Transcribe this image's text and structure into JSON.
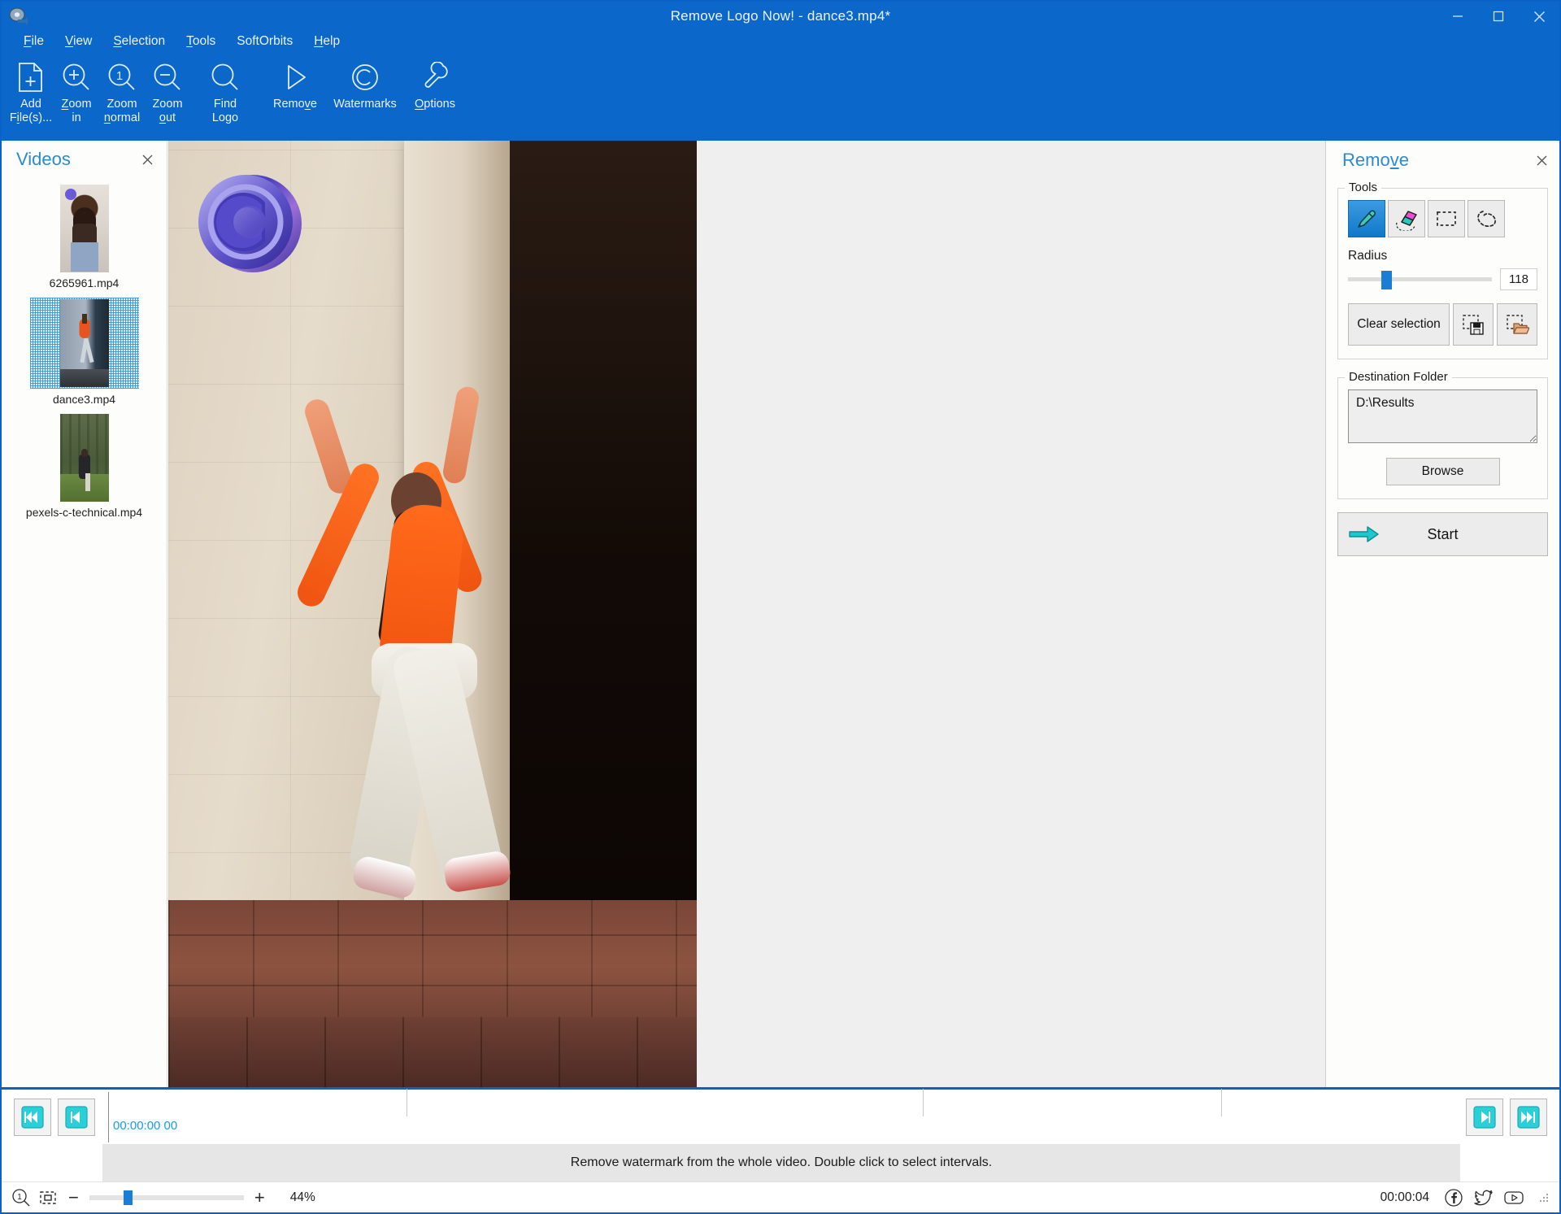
{
  "window": {
    "title": "Remove Logo Now! - dance3.mp4*",
    "app_icon": "disc-arrow-icon",
    "controls": {
      "minimize": "minimize-icon",
      "maximize": "maximize-icon",
      "close": "close-icon"
    }
  },
  "menu": {
    "items": [
      {
        "label": "File",
        "accel": "F"
      },
      {
        "label": "View",
        "accel": "V"
      },
      {
        "label": "Selection",
        "accel": "S"
      },
      {
        "label": "Tools",
        "accel": "T"
      },
      {
        "label": "SoftOrbits",
        "accel": ""
      },
      {
        "label": "Help",
        "accel": "H"
      }
    ]
  },
  "toolbar": {
    "groups": [
      {
        "buttons": [
          {
            "label": "Add\nFile(s)...",
            "icon": "add-file-icon",
            "name": "add-files-button"
          },
          {
            "label": "Zoom\nin",
            "icon": "zoom-in-icon",
            "name": "zoom-in-button"
          },
          {
            "label": "Zoom\nnormal",
            "icon": "zoom-normal-icon",
            "name": "zoom-normal-button"
          },
          {
            "label": "Zoom\nout",
            "icon": "zoom-out-icon",
            "name": "zoom-out-button"
          }
        ]
      },
      {
        "buttons": [
          {
            "label": "Find\nLogo",
            "icon": "magnifier-icon",
            "name": "find-logo-button"
          }
        ]
      },
      {
        "buttons": [
          {
            "label": "Remove",
            "icon": "play-triangle-icon",
            "name": "remove-button"
          },
          {
            "label": "Watermarks",
            "icon": "copyright-icon",
            "name": "watermarks-button"
          }
        ]
      },
      {
        "buttons": [
          {
            "label": "Options",
            "icon": "wrench-icon",
            "name": "options-button"
          }
        ]
      }
    ]
  },
  "videos_panel": {
    "title": "Videos",
    "close_icon": "close-icon",
    "items": [
      {
        "name": "6265961.mp4",
        "selected": false
      },
      {
        "name": "dance3.mp4",
        "selected": true
      },
      {
        "name": "pexels-c-technical.mp4",
        "selected": false
      }
    ]
  },
  "canvas": {
    "watermark": "copyright-logo-watermark"
  },
  "remove_panel": {
    "title": "Remove",
    "title_accel": "v",
    "close_icon": "close-icon",
    "tools_group": {
      "legend": "Tools",
      "tools": [
        {
          "name": "marker-tool",
          "icon": "marker-pen-icon",
          "active": true
        },
        {
          "name": "eraser-tool",
          "icon": "eraser-icon",
          "active": false
        },
        {
          "name": "rectangle-select-tool",
          "icon": "dashed-rectangle-icon",
          "active": false
        },
        {
          "name": "lasso-select-tool",
          "icon": "lasso-icon",
          "active": false
        }
      ],
      "radius_label": "Radius",
      "radius_value": "118",
      "radius_percent": 23,
      "clear_selection_label": "Clear selection",
      "save_selection_icon": "save-selection-icon",
      "load_selection_icon": "load-selection-icon"
    },
    "destination_group": {
      "legend": "Destination Folder",
      "path_value": "D:\\Results",
      "path_placeholder": "D:\\Results",
      "browse_label": "Browse"
    },
    "start_button": {
      "label": "Start",
      "icon": "arrow-right-icon"
    }
  },
  "timeline": {
    "buttons_left": [
      {
        "name": "skip-to-start-button",
        "icon": "rewind-start-icon"
      },
      {
        "name": "previous-frame-button",
        "icon": "prev-frame-icon"
      }
    ],
    "buttons_right": [
      {
        "name": "next-frame-button",
        "icon": "next-frame-icon"
      },
      {
        "name": "skip-to-end-button",
        "icon": "forward-end-icon"
      }
    ],
    "current_time": "00:00:00 00",
    "tick_positions_pct": [
      0,
      22,
      60,
      82
    ]
  },
  "status_bar": {
    "message": "Remove watermark from the whole video. Double click to select intervals."
  },
  "bottom_bar": {
    "zoom_fit_icons": [
      "zoom-one-to-one-icon",
      "fit-to-window-icon"
    ],
    "zoom_out_label": "−",
    "zoom_in_label": "+",
    "zoom_percent": "44%",
    "zoom_slider_percent": 22,
    "total_time": "00:00:04",
    "social": [
      {
        "name": "facebook-icon"
      },
      {
        "name": "twitter-icon"
      },
      {
        "name": "youtube-icon"
      }
    ],
    "grip": "resize-grip-icon"
  },
  "colors": {
    "titlebar": "#0b67c9",
    "accent": "#2a8ad4",
    "selection": "#1a7fd4",
    "teal_button": "#2ad0d8",
    "panel_bg": "#fdfdfb"
  }
}
